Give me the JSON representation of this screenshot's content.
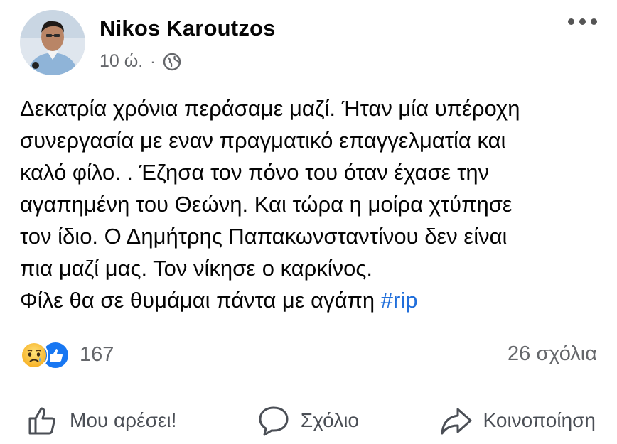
{
  "post": {
    "author": "Nikos Karoutzos",
    "time": "10 ώ.",
    "dot": "·",
    "privacy_icon": "globe-icon",
    "text_lines": [
      "Δεκατρία χρόνια περάσαμε μαζί. Ήταν μία υπέροχη",
      "συνεργασία με εναν πραγματικό επαγγελματία και",
      "καλό φίλο. . Έζησα τον πόνο του όταν έχασε την",
      "αγαπημένη του Θεώνη. Και τώρα η μοίρα χτύπησε",
      "τον ίδιο. Ο Δημήτρης Παπακωνσταντίνου δεν είναι",
      "πια μαζί μας. Τον νίκησε ο καρκίνος."
    ],
    "last_line": "Φίλε θα σε θυμάμαι πάντα με αγάπη",
    "hashtag": "#rip"
  },
  "stats": {
    "reactions_count": "167",
    "reaction_icons": [
      "sad-reaction-icon",
      "like-reaction-icon"
    ],
    "comments": "26 σχόλια"
  },
  "actions": {
    "like_label": "Μου αρέσει!",
    "comment_label": "Σχόλιο",
    "share_label": "Κοινοποίηση"
  },
  "colors": {
    "hashtag": "#216fdb",
    "like_blue": "#1877f2",
    "secondary_text": "#65676b"
  }
}
